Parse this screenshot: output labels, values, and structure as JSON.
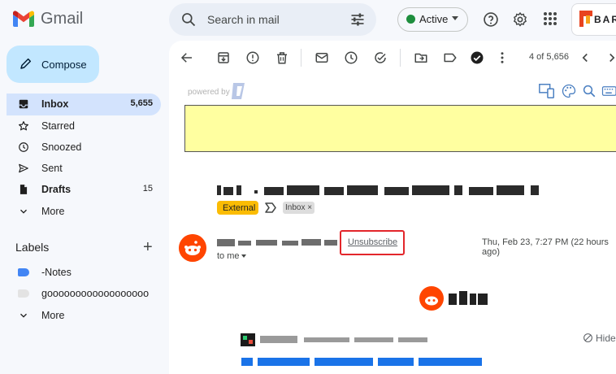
{
  "app": {
    "name": "Gmail"
  },
  "search": {
    "placeholder": "Search in mail"
  },
  "status": {
    "label": "Active",
    "color": "#1e8e3e"
  },
  "brand_partial": "BAR",
  "compose": {
    "label": "Compose"
  },
  "nav": [
    {
      "icon": "inbox-icon",
      "label": "Inbox",
      "count": "5,655",
      "active": true,
      "bold": true
    },
    {
      "icon": "star-icon",
      "label": "Starred",
      "count": ""
    },
    {
      "icon": "clock-icon",
      "label": "Snoozed",
      "count": ""
    },
    {
      "icon": "send-icon",
      "label": "Sent",
      "count": ""
    },
    {
      "icon": "draft-icon",
      "label": "Drafts",
      "count": "15",
      "bold": true
    },
    {
      "icon": "chevron-down-icon",
      "label": "More",
      "count": ""
    }
  ],
  "labels": {
    "title": "Labels",
    "items": [
      {
        "label": "-Notes",
        "color": "#4285f4"
      },
      {
        "label": "goooooooooooooooooo",
        "color": "#e8eaed"
      },
      {
        "label": "More",
        "icon": "chevron-down-icon"
      }
    ]
  },
  "toolbar": {
    "pager": "4 of 5,656"
  },
  "message": {
    "powered_by": "powered by",
    "badge_external": "External",
    "chip_inbox": "Inbox",
    "chip_close": "×",
    "unsubscribe": "Unsubscribe",
    "date": "Thu, Feb 23, 7:27 PM (22 hours ago)",
    "to": "to me",
    "hide": "Hide"
  },
  "colors": {
    "accent": "#0b57d0",
    "compose_bg": "#c2e7ff",
    "nav_active": "#d3e3fd",
    "highlight_box": "#e3262b",
    "reddit": "#ff4500"
  }
}
